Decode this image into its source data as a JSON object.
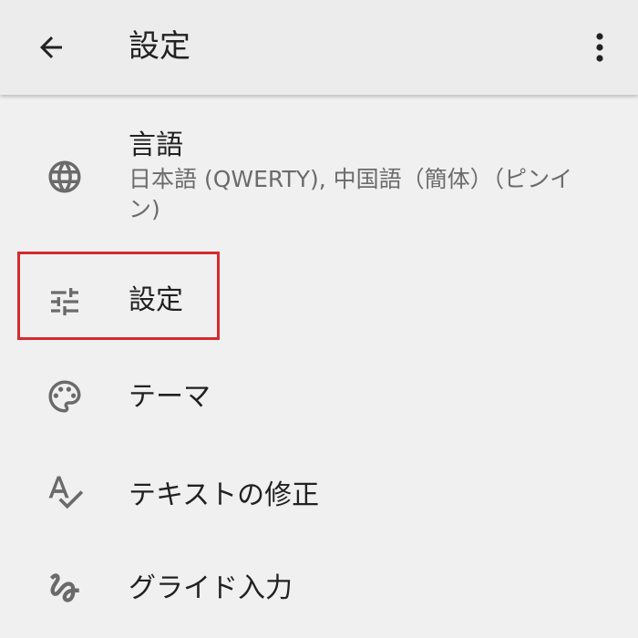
{
  "header": {
    "title": "設定",
    "back_icon": "arrow-back-icon",
    "menu_icon": "more-vert-icon"
  },
  "items": [
    {
      "label": "言語",
      "sublabel": "日本語 (QWERTY), 中国語（簡体）（ピンイン)",
      "icon": "globe-icon"
    },
    {
      "label": "設定",
      "icon": "tune-sliders-icon"
    },
    {
      "label": "テーマ",
      "icon": "palette-icon"
    },
    {
      "label": "テキストの修正",
      "icon": "spellcheck-icon"
    },
    {
      "label": "グライド入力",
      "icon": "gesture-icon"
    }
  ],
  "highlight_color": "#d42b2f",
  "icon_color": "#6a6a6a"
}
